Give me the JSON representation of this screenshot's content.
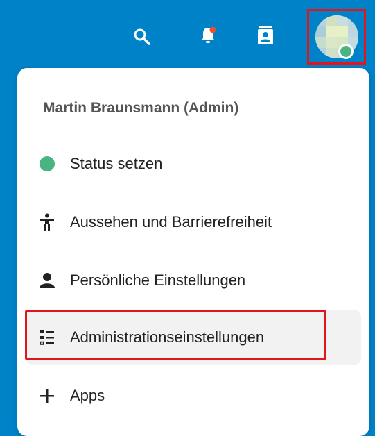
{
  "header": {
    "icons": [
      "search-icon",
      "bell-icon",
      "contacts-icon",
      "avatar"
    ],
    "accent": "#0082c9",
    "notification_color": "#e9512b",
    "highlight_color": "#e3141a"
  },
  "menu": {
    "user_name": "Martin Braunsmann (Admin)",
    "items": [
      {
        "label": "Status setzen",
        "icon": "status-dot-icon"
      },
      {
        "label": "Aussehen und Barrierefreiheit",
        "icon": "accessibility-icon"
      },
      {
        "label": "Persönliche Einstellungen",
        "icon": "user-icon"
      },
      {
        "label": "Administrationseinstellungen",
        "icon": "list-settings-icon"
      },
      {
        "label": "Apps",
        "icon": "plus-icon"
      }
    ],
    "status_color": "#49b382"
  }
}
